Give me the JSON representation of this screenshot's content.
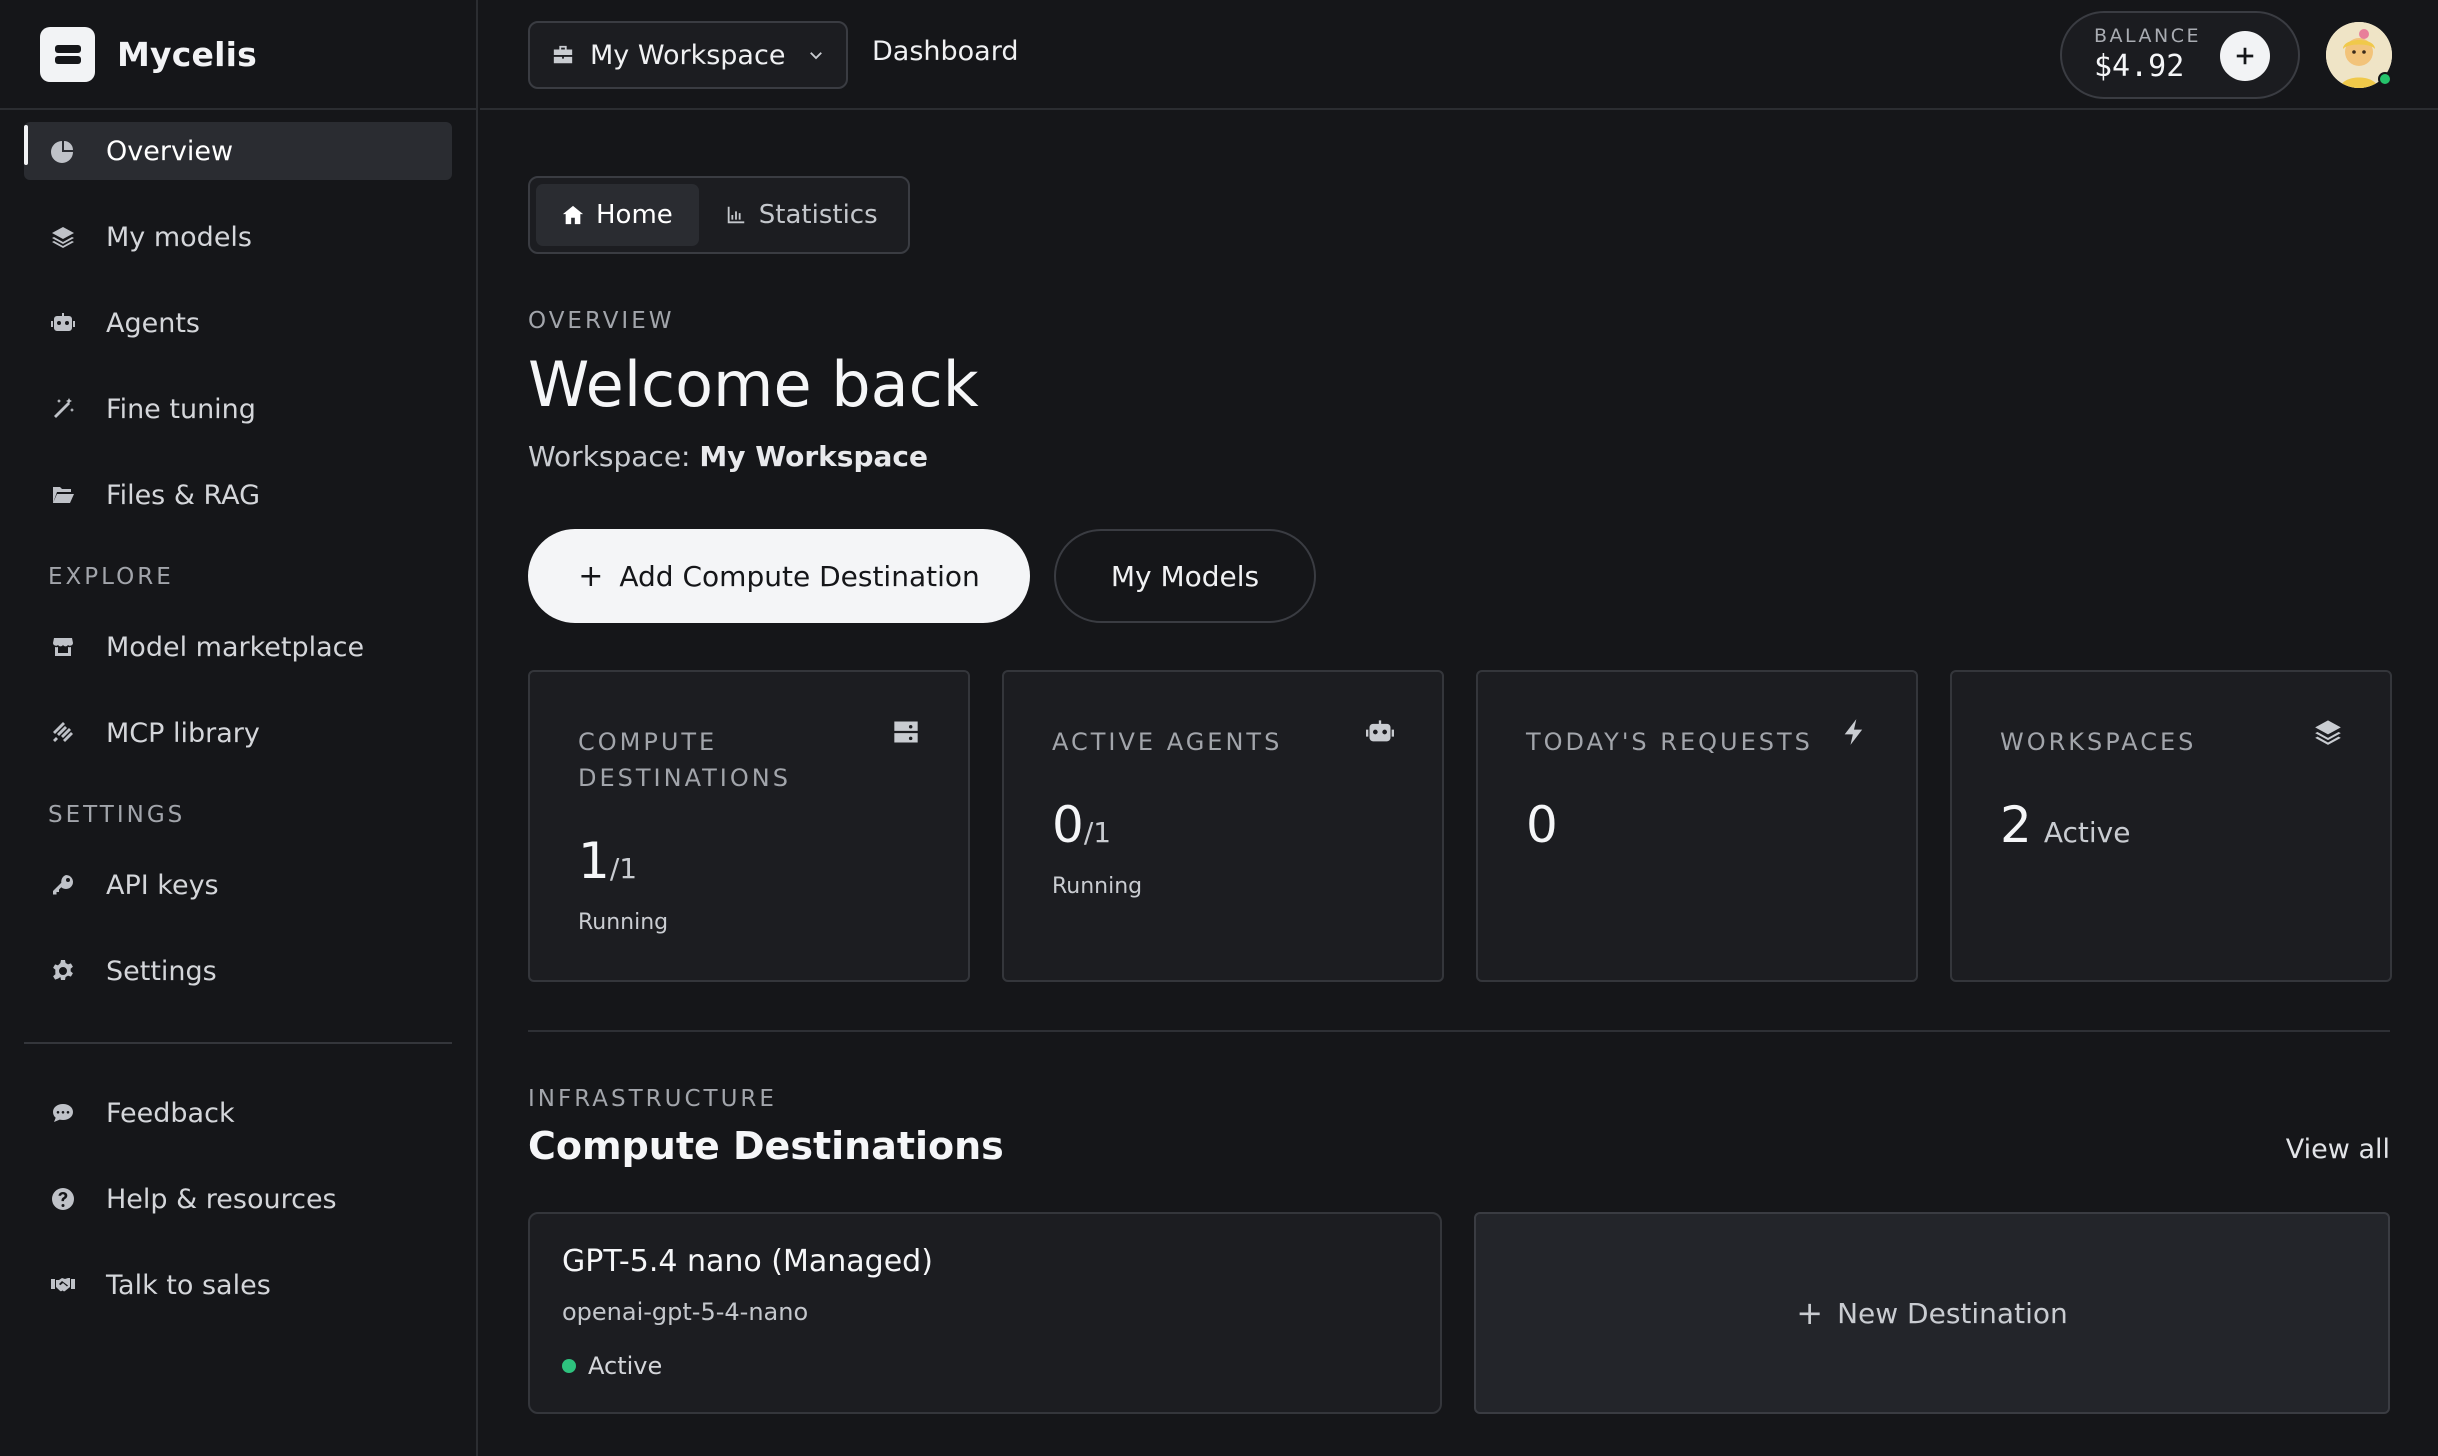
{
  "app": {
    "name": "Mycelis"
  },
  "sidebar": {
    "items": [
      {
        "label": "Overview",
        "icon": "pie-chart-icon",
        "active": true
      },
      {
        "label": "My models",
        "icon": "layers-icon"
      },
      {
        "label": "Agents",
        "icon": "robot-icon"
      },
      {
        "label": "Fine tuning",
        "icon": "magic-wand-icon"
      },
      {
        "label": "Files & RAG",
        "icon": "folder-open-icon"
      }
    ],
    "explore_title": "EXPLORE",
    "explore_items": [
      {
        "label": "Model marketplace",
        "icon": "store-icon"
      },
      {
        "label": "MCP library",
        "icon": "mcp-icon"
      }
    ],
    "settings_title": "SETTINGS",
    "settings_items": [
      {
        "label": "API keys",
        "icon": "key-icon"
      },
      {
        "label": "Settings",
        "icon": "gear-icon"
      }
    ],
    "bottom_items": [
      {
        "label": "Feedback",
        "icon": "chat-bubble-icon"
      },
      {
        "label": "Help & resources",
        "icon": "question-circle-icon"
      },
      {
        "label": "Talk to sales",
        "icon": "handshake-icon"
      }
    ]
  },
  "topbar": {
    "workspace": "My Workspace",
    "breadcrumb": "Dashboard",
    "balance_label": "BALANCE",
    "balance_value": "$4.92"
  },
  "tabs": [
    {
      "label": "Home",
      "icon": "home-icon",
      "active": true
    },
    {
      "label": "Statistics",
      "icon": "bar-chart-icon"
    }
  ],
  "overview": {
    "eyebrow": "OVERVIEW",
    "title": "Welcome back",
    "workspace_prefix": "Workspace:",
    "workspace_name": "My Workspace",
    "add_button": "Add Compute Destination",
    "models_button": "My Models"
  },
  "stats": {
    "compute": {
      "label": "COMPUTE DESTINATIONS",
      "value": "1",
      "total": "/1",
      "sub": "Running",
      "icon": "server-icon"
    },
    "agents": {
      "label": "ACTIVE AGENTS",
      "value": "0",
      "total": "/1",
      "sub": "Running",
      "icon": "robot-icon"
    },
    "requests": {
      "label": "TODAY'S REQUESTS",
      "value": "0",
      "icon": "lightning-icon"
    },
    "workspaces": {
      "label": "WORKSPACES",
      "value": "2",
      "sub": "Active",
      "icon": "layers-icon"
    }
  },
  "infrastructure": {
    "eyebrow": "INFRASTRUCTURE",
    "title": "Compute Destinations",
    "view_all": "View all",
    "destination": {
      "name": "GPT-5.4 nano (Managed)",
      "id": "openai-gpt-5-4-nano",
      "status": "Active",
      "status_color": "#2ec27e"
    },
    "new_destination": "New Destination"
  }
}
